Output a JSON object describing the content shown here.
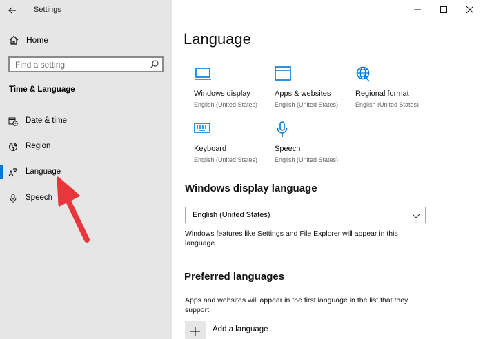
{
  "window": {
    "title": "Settings"
  },
  "sidebar": {
    "home_label": "Home",
    "search_placeholder": "Find a setting",
    "section_title": "Time & Language",
    "items": [
      {
        "label": "Date & time",
        "icon": "calendar-clock-icon"
      },
      {
        "label": "Region",
        "icon": "globe-region-icon"
      },
      {
        "label": "Language",
        "icon": "language-icon",
        "active": true
      },
      {
        "label": "Speech",
        "icon": "microphone-icon"
      }
    ]
  },
  "main": {
    "title": "Language",
    "tiles": [
      {
        "title": "Windows display",
        "subtitle": "English (United States)",
        "icon": "monitor-icon"
      },
      {
        "title": "Apps & websites",
        "subtitle": "English (United States)",
        "icon": "browser-window-icon"
      },
      {
        "title": "Regional format",
        "subtitle": "English (United States)",
        "icon": "globe-icon"
      },
      {
        "title": "Keyboard",
        "subtitle": "English (United States)",
        "icon": "keyboard-icon"
      },
      {
        "title": "Speech",
        "subtitle": "English (United States)",
        "icon": "microphone-icon"
      }
    ],
    "display_language": {
      "heading": "Windows display language",
      "selected": "English (United States)",
      "description": "Windows features like Settings and File Explorer will appear in this language."
    },
    "preferred": {
      "heading": "Preferred languages",
      "description": "Apps and websites will appear in the first language in the list that they support.",
      "add_label": "Add a language"
    }
  },
  "colors": {
    "accent": "#0078d7",
    "sidebar_bg": "#e6e6e6",
    "arrow": "#e8363b"
  }
}
